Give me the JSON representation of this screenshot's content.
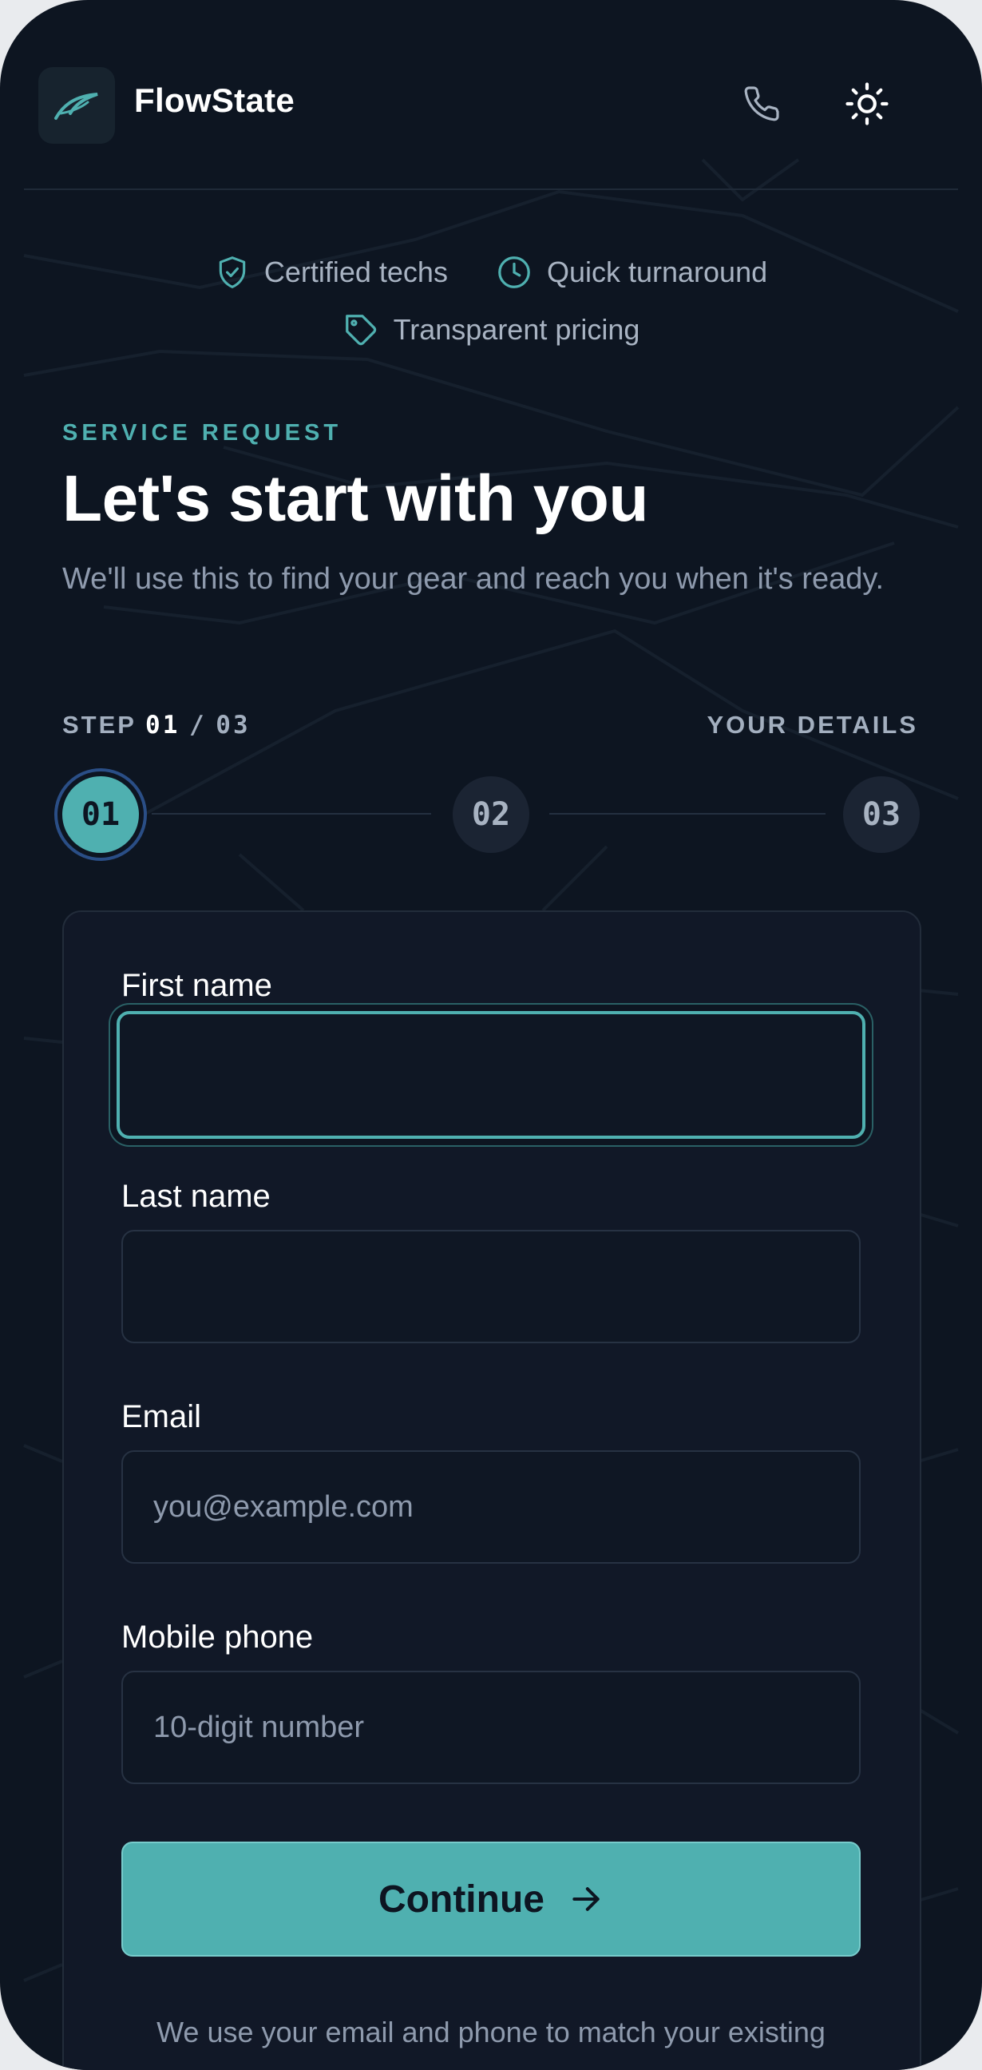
{
  "header": {
    "brand": "FlowState",
    "logo_icon": "feather-logo-icon",
    "call_icon": "phone-icon",
    "theme_icon": "sun-icon"
  },
  "trust_badges": [
    {
      "icon": "shield-check-icon",
      "label": "Certified techs"
    },
    {
      "icon": "clock-icon",
      "label": "Quick turnaround"
    },
    {
      "icon": "tag-icon",
      "label": "Transparent pricing"
    }
  ],
  "intro": {
    "eyebrow": "SERVICE REQUEST",
    "title": "Let's start with you",
    "subtitle": "We'll use this to find your gear and reach you when it's ready."
  },
  "stepper": {
    "prefix": "STEP",
    "current": "01",
    "separator": "/",
    "total": "03",
    "section_name": "YOUR DETAILS",
    "steps": [
      "01",
      "02",
      "03"
    ],
    "active_index": 0
  },
  "form": {
    "first_name": {
      "label": "First name",
      "value": "",
      "placeholder": ""
    },
    "last_name": {
      "label": "Last name",
      "value": "",
      "placeholder": ""
    },
    "email": {
      "label": "Email",
      "value": "",
      "placeholder": "you@example.com"
    },
    "phone": {
      "label": "Mobile phone",
      "value": "",
      "placeholder": "10-digit number"
    },
    "continue_label": "Continue",
    "continue_icon": "arrow-right-icon",
    "footnote": "We use your email and phone to match your existing"
  },
  "colors": {
    "accent": "#4fb0b0",
    "background": "#0d1521",
    "card": "#111827",
    "text_primary": "#ffffff",
    "text_muted": "#8e9aad"
  }
}
